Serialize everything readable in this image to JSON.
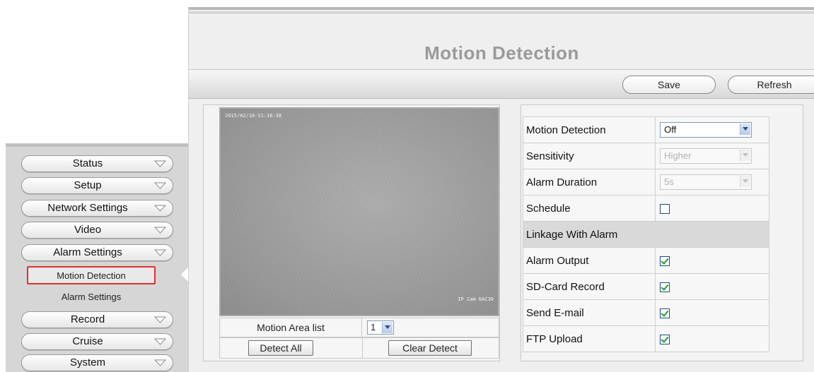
{
  "sidebar": {
    "items": [
      {
        "label": "Status"
      },
      {
        "label": "Setup"
      },
      {
        "label": "Network Settings"
      },
      {
        "label": "Video"
      },
      {
        "label": "Alarm Settings"
      }
    ],
    "sub_items": [
      {
        "label": "Motion Detection",
        "selected": true
      },
      {
        "label": "Alarm Settings",
        "selected": false
      }
    ],
    "items_after": [
      {
        "label": "Record"
      },
      {
        "label": "Cruise"
      },
      {
        "label": "System"
      }
    ]
  },
  "page": {
    "title": "Motion Detection"
  },
  "toolbar": {
    "save_label": "Save",
    "refresh_label": "Refresh"
  },
  "video": {
    "timestamp": "2015/02/10-11:16:38",
    "camera_name": "IP Cam 6AC30"
  },
  "motion_area": {
    "label": "Motion Area list",
    "selected": "1",
    "detect_all_label": "Detect All",
    "clear_detect_label": "Clear Detect"
  },
  "settings": {
    "motion_detection": {
      "label": "Motion Detection",
      "value": "Off"
    },
    "sensitivity": {
      "label": "Sensitivity",
      "value": "Higher"
    },
    "alarm_duration": {
      "label": "Alarm Duration",
      "value": "5s"
    },
    "schedule": {
      "label": "Schedule",
      "checked": false
    },
    "linkage_header": "Linkage With Alarm",
    "alarm_output": {
      "label": "Alarm Output",
      "checked": true
    },
    "sd_card_record": {
      "label": "SD-Card Record",
      "checked": true
    },
    "send_email": {
      "label": "Send E-mail",
      "checked": true
    },
    "ftp_upload": {
      "label": "FTP Upload",
      "checked": true
    }
  },
  "colors": {
    "selected_outline": "#e0312b",
    "checkbox_check": "#1f9a26",
    "title_gray": "#9a9a9a"
  }
}
